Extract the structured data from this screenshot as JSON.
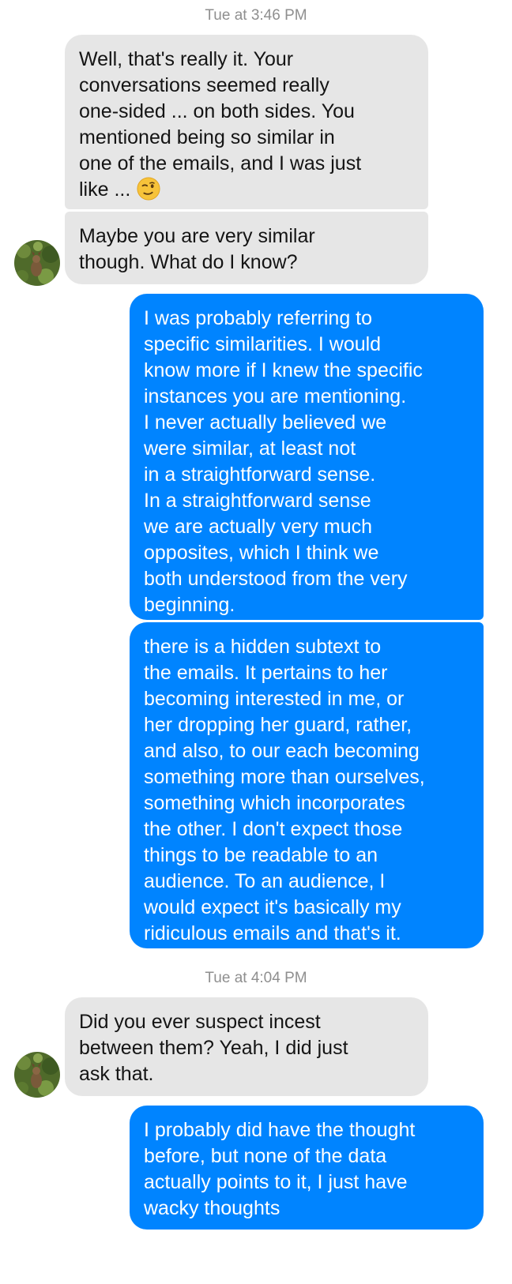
{
  "timestamps": {
    "first": "Tue at 3:46 PM",
    "second": "Tue at 4:04 PM"
  },
  "messages": [
    {
      "sender": "other",
      "text": "Well, that's really it. Your\nconversations seemed really\none-sided ... on both sides. You\nmentioned being so similar in\none of the emails, and I was just\nlike ...",
      "emoji": "winking-face-emoji"
    },
    {
      "sender": "other",
      "text": "Maybe you are very similar\nthough. What do I know?"
    },
    {
      "sender": "me",
      "text": "I was probably referring to\nspecific similarities. I would\nknow more if I knew the specific\ninstances you are mentioning.\nI never actually believed we\nwere similar, at least not\nin a straightforward sense.\nIn a straightforward sense\nwe are actually very much\nopposites, which I think we\nboth understood from the very\nbeginning."
    },
    {
      "sender": "me",
      "text": "there is a hidden subtext to\nthe emails. It pertains to her\nbecoming interested in me, or\nher dropping her guard, rather,\nand also, to our each becoming\nsomething more than ourselves,\nsomething which incorporates\nthe other. I don't expect those\nthings to be readable to an\naudience. To an audience, I\nwould expect it's basically my\nridiculous emails and that's it."
    },
    {
      "sender": "other",
      "text": "Did you ever suspect incest\nbetween them? Yeah, I did just\nask that."
    },
    {
      "sender": "me",
      "text": "I probably did have the thought\nbefore, but none of the data\nactually points to it, I just have\nwacky thoughts"
    }
  ],
  "colors": {
    "incoming_bubble": "#e6e6e6",
    "outgoing_bubble": "#0084ff",
    "timestamp_text": "#8f8f8f"
  }
}
